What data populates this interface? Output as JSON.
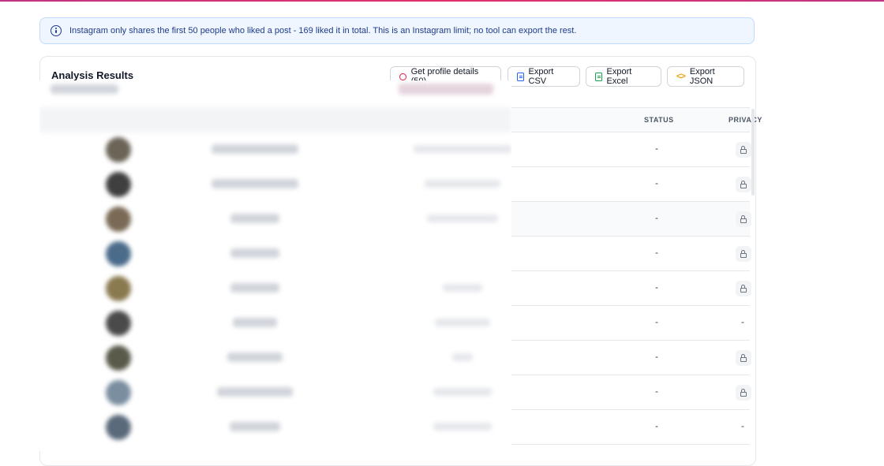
{
  "notice": {
    "icon": "info-icon",
    "text": "Instagram only shares the first 50 people who liked a post - 169 liked it in total. This is an Instagram limit; no tool can export the rest."
  },
  "results": {
    "title": "Analysis Results",
    "buttons": {
      "profile": "Get profile details (50)",
      "csv": "Export CSV",
      "excel": "Export Excel",
      "json": "Export JSON"
    }
  },
  "table": {
    "headers": {
      "status": "STATUS",
      "privacy": "PRIVACY"
    },
    "rows": [
      {
        "status": "-",
        "privacy": "lock"
      },
      {
        "status": "-",
        "privacy": "lock"
      },
      {
        "status": "-",
        "privacy": "lock"
      },
      {
        "status": "-",
        "privacy": "lock"
      },
      {
        "status": "-",
        "privacy": "lock"
      },
      {
        "status": "-",
        "privacy": "-"
      },
      {
        "status": "-",
        "privacy": "lock"
      },
      {
        "status": "-",
        "privacy": "lock"
      },
      {
        "status": "-",
        "privacy": "-"
      }
    ]
  },
  "colors": {
    "accent": "#e1306c",
    "notice_bg": "#eff6ff",
    "notice_text": "#1e3a8a"
  }
}
